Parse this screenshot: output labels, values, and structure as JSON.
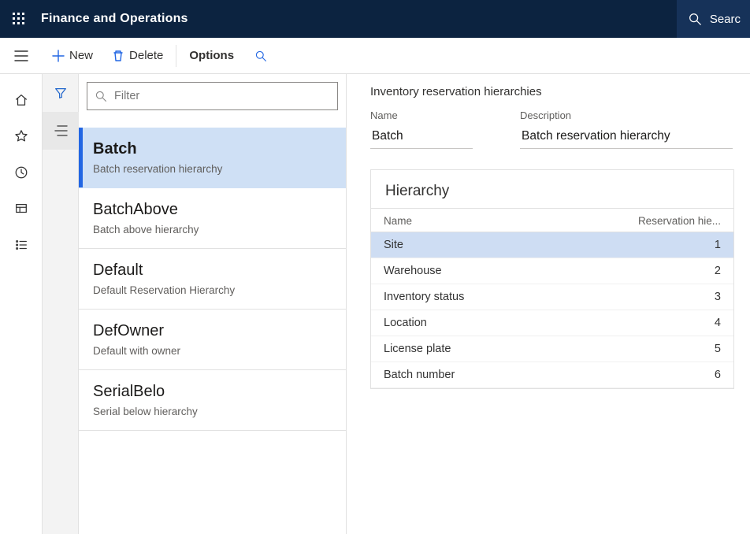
{
  "header": {
    "app_title": "Finance and Operations",
    "search_label": "Searc"
  },
  "toolbar": {
    "new_label": "New",
    "delete_label": "Delete",
    "options_label": "Options"
  },
  "list": {
    "filter_placeholder": "Filter",
    "records": [
      {
        "title": "Batch",
        "subtitle": "Batch reservation hierarchy",
        "selected": true
      },
      {
        "title": "BatchAbove",
        "subtitle": "Batch above hierarchy",
        "selected": false
      },
      {
        "title": "Default",
        "subtitle": "Default Reservation Hierarchy",
        "selected": false
      },
      {
        "title": "DefOwner",
        "subtitle": "Default with owner",
        "selected": false
      },
      {
        "title": "SerialBelo",
        "subtitle": "Serial below hierarchy",
        "selected": false
      }
    ]
  },
  "detail": {
    "page_title": "Inventory reservation hierarchies",
    "name_label": "Name",
    "name_value": "Batch",
    "description_label": "Description",
    "description_value": "Batch reservation hierarchy",
    "hierarchy_section_title": "Hierarchy",
    "grid": {
      "col_name": "Name",
      "col_level": "Reservation hie...",
      "rows": [
        {
          "name": "Site",
          "level": 1,
          "selected": true
        },
        {
          "name": "Warehouse",
          "level": 2,
          "selected": false
        },
        {
          "name": "Inventory status",
          "level": 3,
          "selected": false
        },
        {
          "name": "Location",
          "level": 4,
          "selected": false
        },
        {
          "name": "License plate",
          "level": 5,
          "selected": false
        },
        {
          "name": "Batch number",
          "level": 6,
          "selected": false
        }
      ]
    }
  }
}
